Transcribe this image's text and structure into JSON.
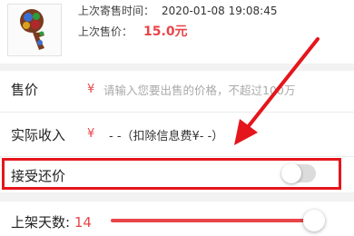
{
  "item": {
    "last_listing_time_label": "上次寄售时间：",
    "last_listing_time_value": "2020-01-08 19:08:45",
    "last_price_label": "上次售价：",
    "last_price_value": "15.0元"
  },
  "form": {
    "price": {
      "label": "售价",
      "currency": "¥",
      "placeholder": "请输入您要出售的价格，不超过100万"
    },
    "income": {
      "label": "实际收入",
      "currency": "¥",
      "value": "- -（扣除信息费¥- -）"
    },
    "accept_counteroffer": {
      "label": "接受还价",
      "enabled": false
    },
    "listing_days": {
      "label": "上架天数:",
      "value": "14"
    }
  },
  "colors": {
    "accent": "#e8454a",
    "annotation": "#e5151c",
    "toggle_off": "#dcdcdc"
  },
  "icons": {
    "thumbnail": "item-thumbnail-image",
    "annotation": "red-arrow-icon"
  }
}
